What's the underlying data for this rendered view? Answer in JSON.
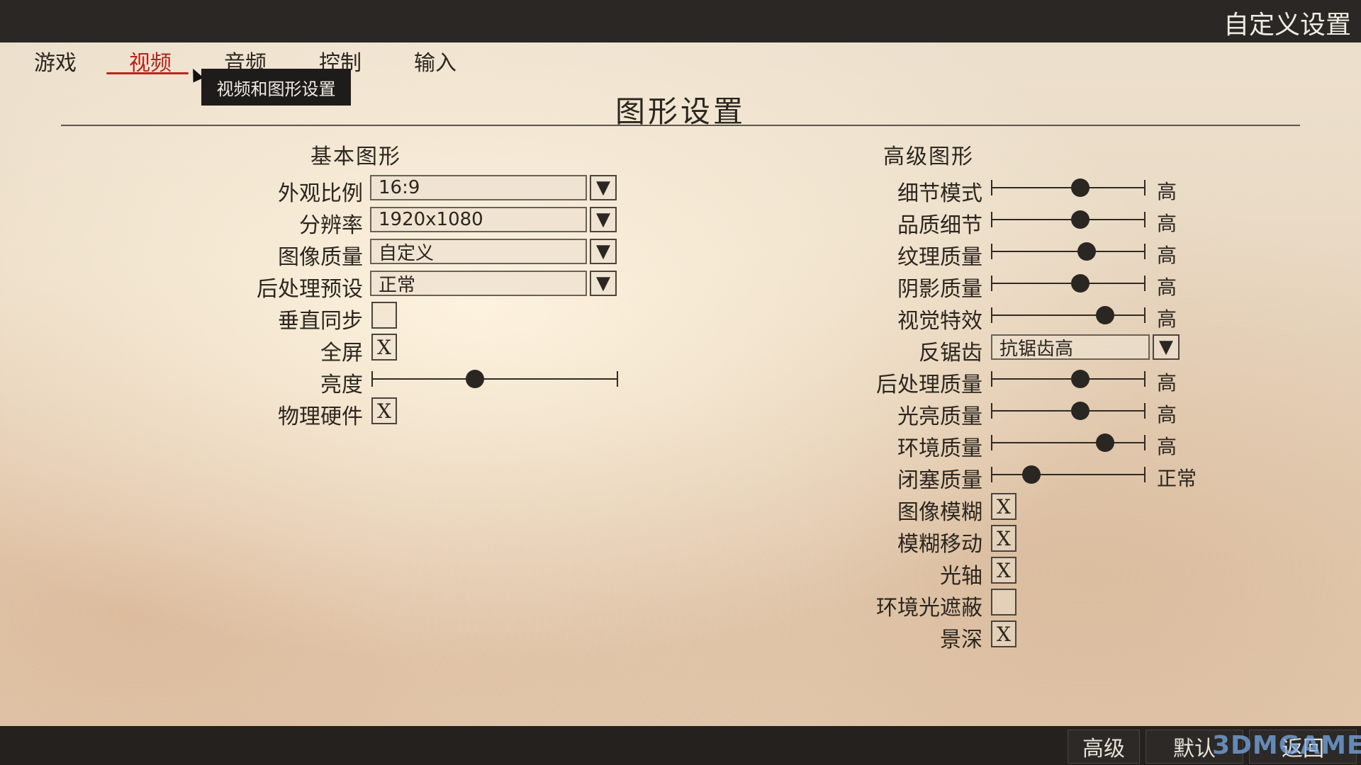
{
  "header": {
    "title": "自定义设置"
  },
  "tabs": [
    {
      "label": "游戏"
    },
    {
      "label": "视频"
    },
    {
      "label": "音频"
    },
    {
      "label": "控制"
    },
    {
      "label": "输入"
    }
  ],
  "tooltip": "视频和图形设置",
  "heading": "图形设置",
  "basic": {
    "title": "基本图形",
    "aspect": {
      "label": "外观比例",
      "value": "16:9"
    },
    "resolution": {
      "label": "分辨率",
      "value": "1920x1080"
    },
    "image_quality": {
      "label": "图像质量",
      "value": "自定义"
    },
    "postprocess_preset": {
      "label": "后处理预设",
      "value": "正常"
    },
    "vsync": {
      "label": "垂直同步",
      "checked": false,
      "mark": ""
    },
    "fullscreen": {
      "label": "全屏",
      "checked": true,
      "mark": "X"
    },
    "brightness": {
      "label": "亮度",
      "level": 0.42
    },
    "physics_hw": {
      "label": "物理硬件",
      "checked": true,
      "mark": "X"
    }
  },
  "advanced": {
    "title": "高级图形",
    "detail_mode": {
      "label": "细节模式",
      "level": 0.58,
      "value": "高"
    },
    "quality_detail": {
      "label": "品质细节",
      "level": 0.58,
      "value": "高"
    },
    "texture_quality": {
      "label": "纹理质量",
      "level": 0.62,
      "value": "高"
    },
    "shadow_quality": {
      "label": "阴影质量",
      "level": 0.58,
      "value": "高"
    },
    "visual_effects": {
      "label": "视觉特效",
      "level": 0.74,
      "value": "高"
    },
    "antialias": {
      "label": "反锯齿",
      "value": "抗锯齿高"
    },
    "postprocess_quality": {
      "label": "后处理质量",
      "level": 0.58,
      "value": "高"
    },
    "lighting_quality": {
      "label": "光亮质量",
      "level": 0.58,
      "value": "高"
    },
    "environment_quality": {
      "label": "环境质量",
      "level": 0.74,
      "value": "高"
    },
    "occlusion_quality": {
      "label": "闭塞质量",
      "level": 0.26,
      "value": "正常"
    },
    "image_blur": {
      "label": "图像模糊",
      "checked": true,
      "mark": "X"
    },
    "motion_blur": {
      "label": "模糊移动",
      "checked": true,
      "mark": "X"
    },
    "light_shafts": {
      "label": "光轴",
      "checked": true,
      "mark": "X"
    },
    "ambient_occlusion": {
      "label": "环境光遮蔽",
      "checked": false,
      "mark": ""
    },
    "depth_of_field": {
      "label": "景深",
      "checked": true,
      "mark": "X"
    }
  },
  "footer": {
    "advanced": "高级",
    "default": "默认",
    "back": "返回",
    "watermark": "3DMGAME"
  }
}
